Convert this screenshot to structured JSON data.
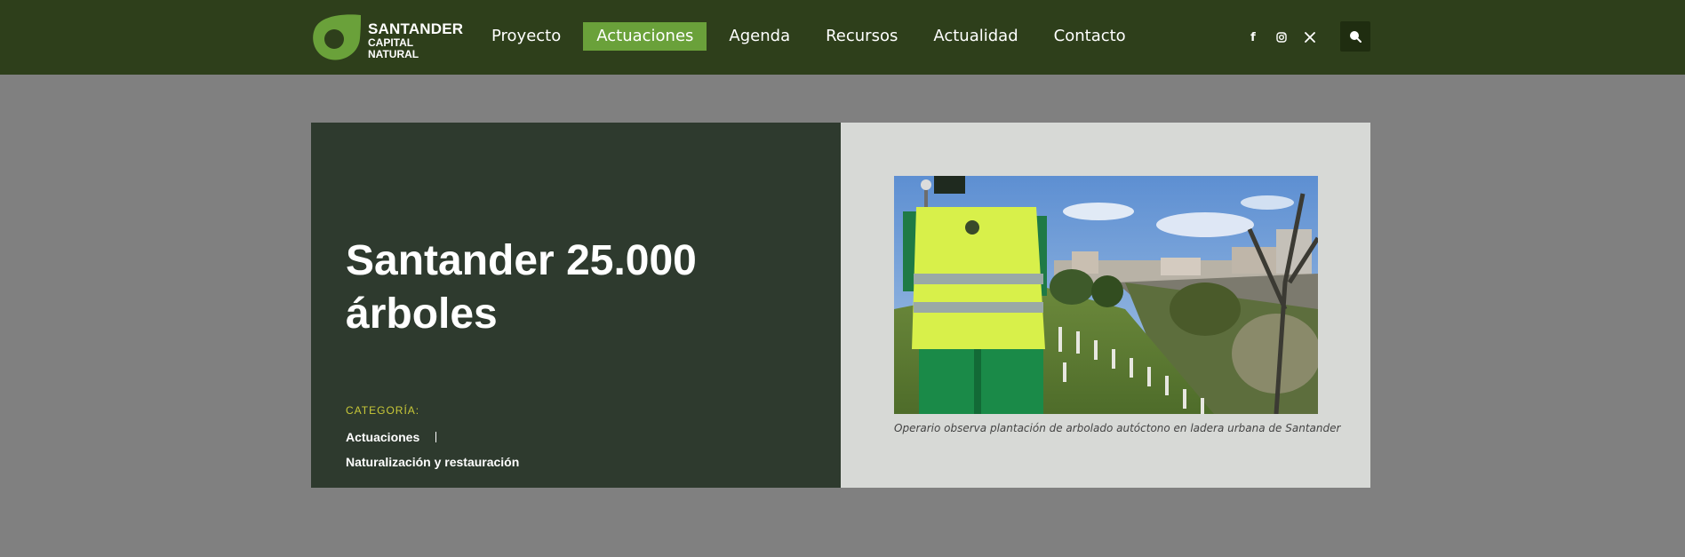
{
  "brand": {
    "line1": "SANTANDER",
    "line2": "CAPITAL",
    "line3": "NATURAL",
    "logo_icon": "leaf-ring-logo",
    "accent_color": "#6aa13a"
  },
  "nav": {
    "items": [
      {
        "label": "Proyecto",
        "active": false
      },
      {
        "label": "Actuaciones",
        "active": true
      },
      {
        "label": "Agenda",
        "active": false
      },
      {
        "label": "Recursos",
        "active": false
      },
      {
        "label": "Actualidad",
        "active": false
      },
      {
        "label": "Contacto",
        "active": false
      }
    ]
  },
  "social": {
    "facebook": "f",
    "instagram": "instagram-icon",
    "x": "𝕏"
  },
  "search": {
    "icon": "search-icon"
  },
  "article": {
    "title": "Santander 25.000 árboles",
    "category_label": "CATEGORÍA:",
    "categories": [
      "Actuaciones",
      "Naturalización y restauración"
    ],
    "image_caption": "Operario observa plantación de arbolado autóctono en ladera urbana de Santander"
  },
  "colors": {
    "header_bg": "#2e3f1b",
    "page_bg": "#808080",
    "card_left_bg": "#2e3a2e",
    "card_right_bg": "#d7d9d6",
    "category_label": "#c8c838"
  }
}
